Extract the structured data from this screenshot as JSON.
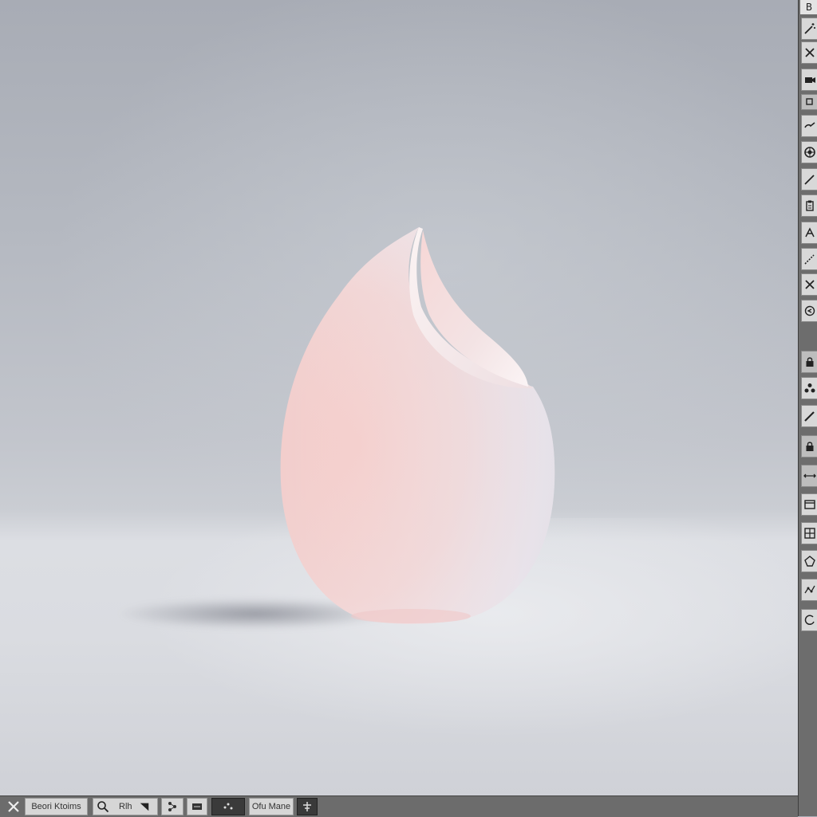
{
  "right_toolbar": {
    "label": "B",
    "tools": [
      "magic-wand-icon",
      "close-icon",
      "camera-icon",
      "small-square-icon",
      "wrench-icon",
      "sphere-icon",
      "pen-icon",
      "clipboard-icon",
      "transform-icon",
      "brush-icon",
      "close-icon",
      "rotate-icon",
      "lock-icon",
      "nodes-icon",
      "knife-icon",
      "lock-icon",
      "scale-icon",
      "panel-icon",
      "grid-icon",
      "shape-icon",
      "graph-icon",
      "refresh-icon"
    ]
  },
  "bottom_bar": {
    "search_label": "Beori Ktoims",
    "field_label": "Rlh",
    "mode_label": "Ofu Mane"
  },
  "colors": {
    "accent_vase": "#f2d2d0",
    "toolbar_bg": "#6d6d6d",
    "button_bg": "#d8d8d8"
  }
}
